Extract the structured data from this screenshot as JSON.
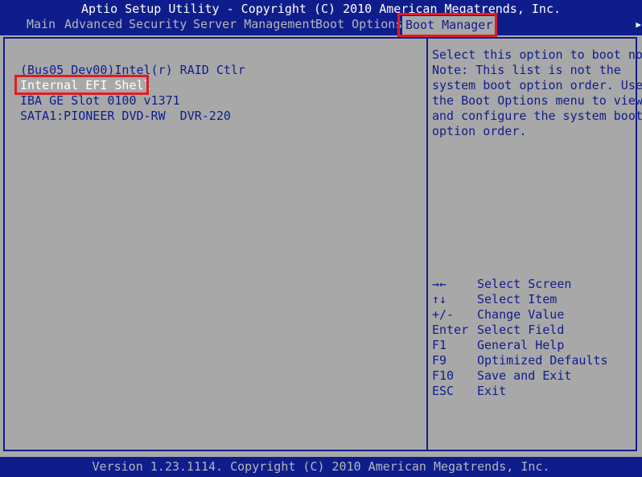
{
  "header": {
    "title": "Aptio Setup Utility - Copyright (C) 2010 American Megatrends, Inc.",
    "tabs": [
      {
        "label": "Main"
      },
      {
        "label": "Advanced"
      },
      {
        "label": "Security"
      },
      {
        "label": "Server Management"
      },
      {
        "label": "Boot Options"
      },
      {
        "label": "Boot Manager",
        "active": true
      }
    ],
    "scroll_indicator": "▶"
  },
  "boot_manager": {
    "items": [
      {
        "label": "(Bus05 Dev00)Intel(r) RAID Ctlr"
      },
      {
        "label": "Internal EFI Shell",
        "selected": true
      },
      {
        "label": "IBA GE Slot 0100 v1371"
      },
      {
        "label": "SATA1:PIONEER DVD-RW  DVR-220"
      }
    ]
  },
  "help": {
    "lines": [
      "Select this option to boot now.",
      "Note: This list is not the",
      "system boot option order. Use",
      "the Boot Options menu to view",
      "and configure the system boot",
      "option order."
    ]
  },
  "keys": [
    {
      "key": "→←",
      "desc": "Select Screen"
    },
    {
      "key": "↑↓",
      "desc": "Select Item"
    },
    {
      "key": "+/-",
      "desc": "Change Value"
    },
    {
      "key": "Enter",
      "desc": "Select Field"
    },
    {
      "key": "F1",
      "desc": "General Help"
    },
    {
      "key": "F9",
      "desc": "Optimized Defaults"
    },
    {
      "key": "F10",
      "desc": "Save and Exit"
    },
    {
      "key": "ESC",
      "desc": "Exit"
    }
  ],
  "footer": {
    "text": "Version 1.23.1114. Copyright (C) 2010 American Megatrends, Inc."
  },
  "colors": {
    "bios_blue": "#0f1d8c",
    "bios_gray": "#a8a8a8",
    "annotation_red": "#e21b22"
  }
}
